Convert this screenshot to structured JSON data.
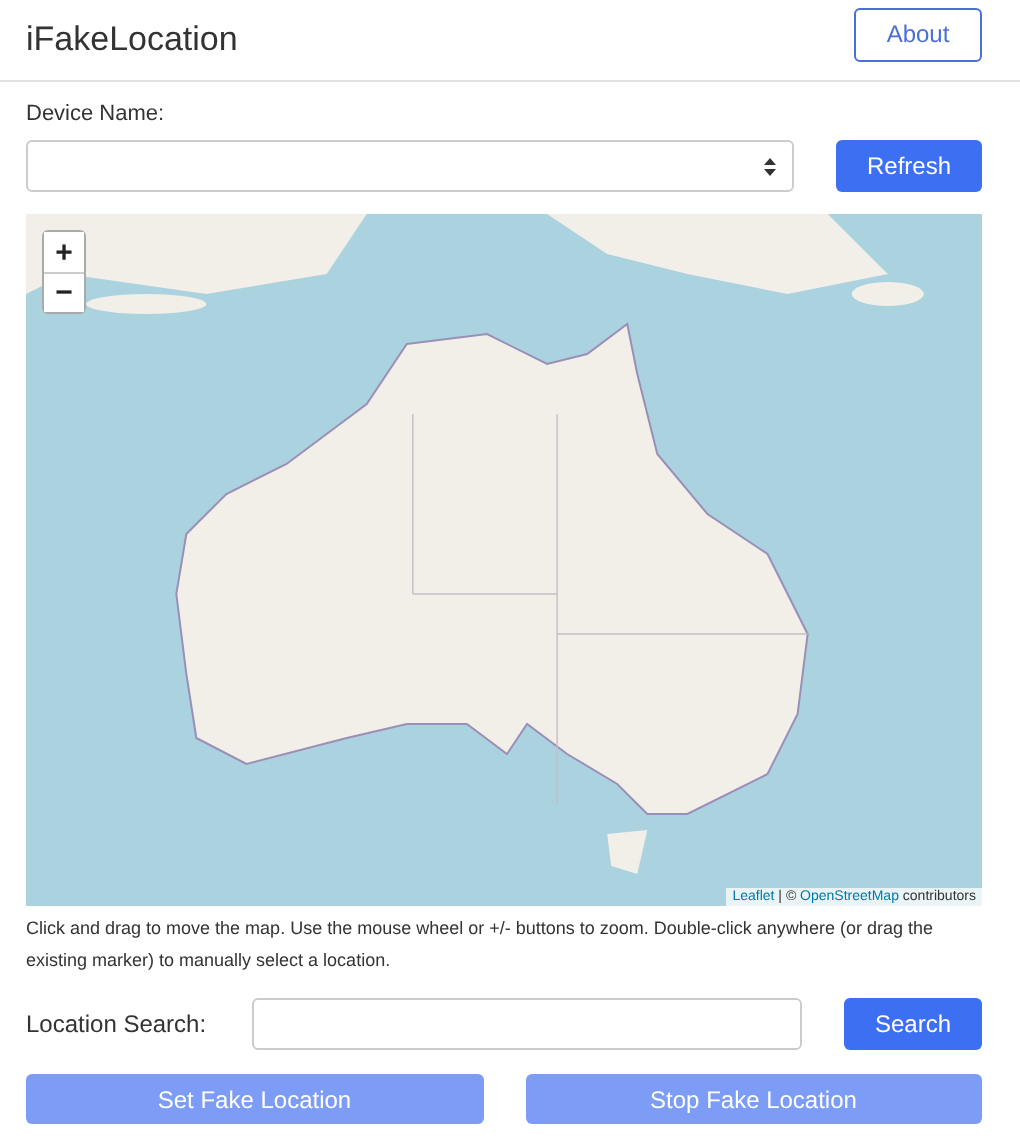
{
  "header": {
    "title": "iFakeLocation",
    "about_button": "About"
  },
  "device": {
    "label": "Device Name:",
    "refresh_button": "Refresh"
  },
  "map": {
    "kind": "picture",
    "zoom_in": "+",
    "zoom_out": "−",
    "attribution": [
      {
        "kind": "link",
        "text": "Leaflet"
      },
      {
        "kind": "text",
        "text": " | © "
      },
      {
        "kind": "link",
        "text": "OpenStreetMap"
      },
      {
        "kind": "text",
        "text": " contributors"
      }
    ]
  },
  "help_text": "Click and drag to move the map. Use the mouse wheel or +/- buttons to zoom. Double-click anywhere (or drag the existing marker) to manually select a location.",
  "search": {
    "label": "Location Search:",
    "button": "Search"
  },
  "actions": [
    {
      "label": "Set Fake Location",
      "disabled": true
    },
    {
      "label": "Stop Fake Location",
      "disabled": true
    }
  ]
}
